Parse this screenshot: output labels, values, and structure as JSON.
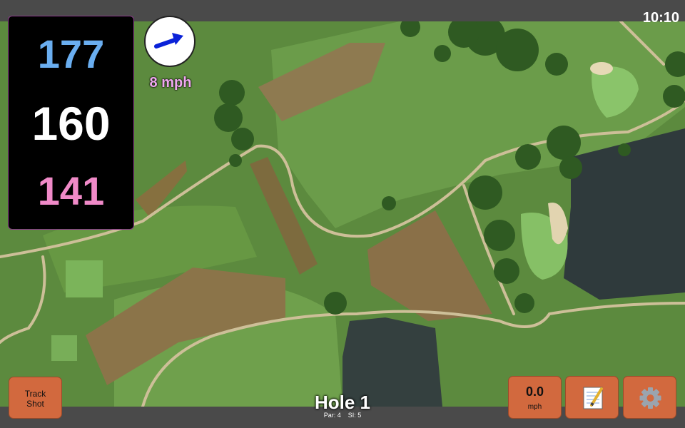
{
  "status": {
    "time": "10:10"
  },
  "distances": {
    "back": "177",
    "center": "160",
    "front": "141",
    "colors": {
      "back": "#6aaef0",
      "center": "#ffffff",
      "front": "#f08ac8"
    }
  },
  "wind": {
    "speed_label": "8 mph",
    "icon": "wind-direction-arrow-icon",
    "arrow_color": "#0a22d8"
  },
  "buttons": {
    "track_shot": "Track\nShot",
    "speed_value": "0.0",
    "speed_unit": "mph",
    "notes_icon": "notepad-icon",
    "settings_icon": "gear-icon",
    "accent": "#d2693e"
  },
  "hole": {
    "title": "Hole 1",
    "par": "Par: 4",
    "si": "SI: 5"
  },
  "map": {
    "type": "satellite golf course view"
  }
}
